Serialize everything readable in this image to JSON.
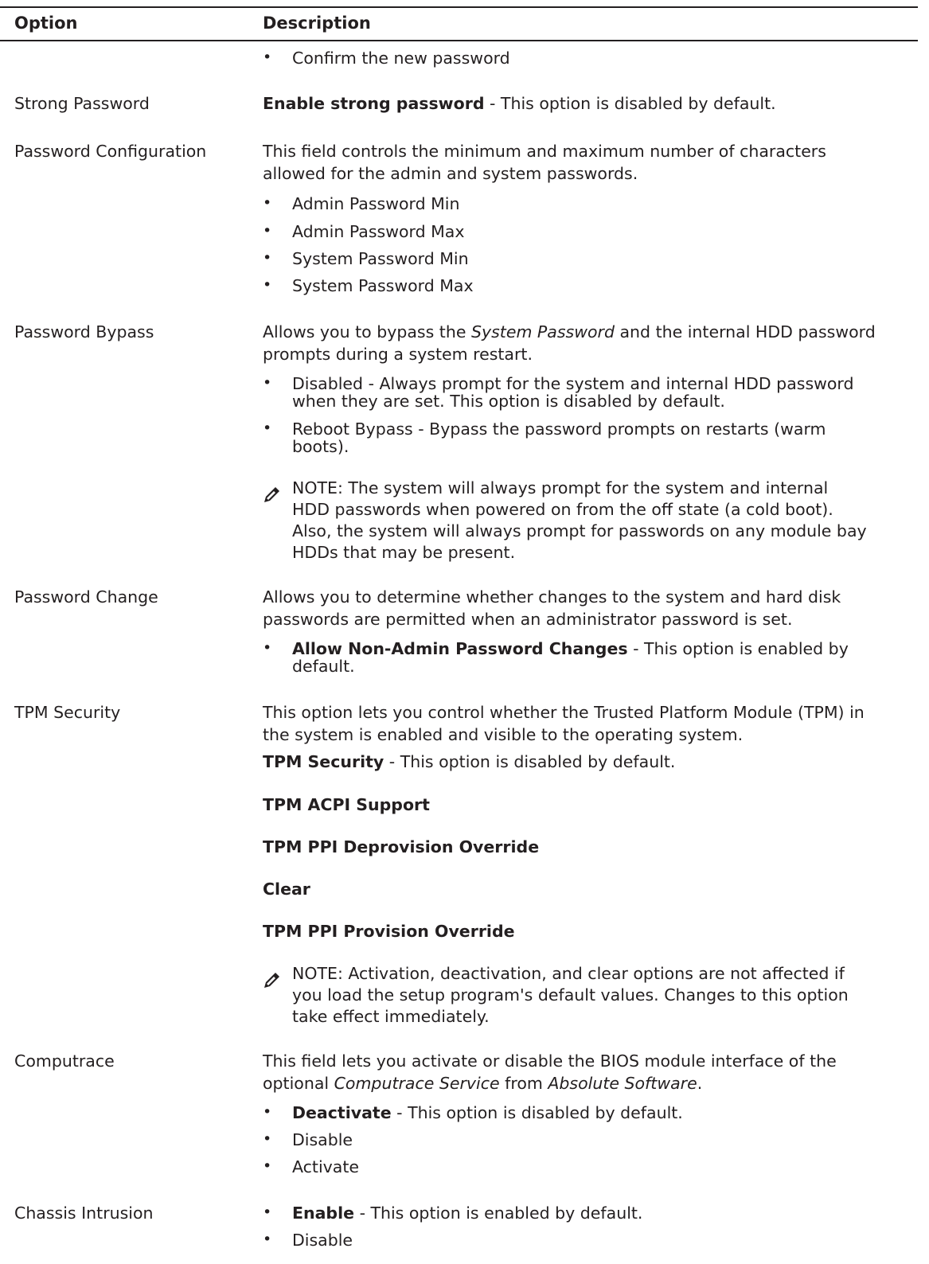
{
  "header": {
    "option": "Option",
    "description": "Description"
  },
  "rows": {
    "confirm": {
      "bullet": "Confirm the new password"
    },
    "strong": {
      "option": "Strong Password",
      "bold": "Enable strong password",
      "rest": " - This option is disabled by default."
    },
    "pwconfig": {
      "option": "Password Configuration",
      "desc1": "This field controls the minimum and maximum number of characters",
      "desc2": "allowed for the admin and system passwords.",
      "items": [
        "Admin Password Min",
        "Admin Password Max",
        "System Password Min",
        "System Password Max"
      ]
    },
    "bypass": {
      "option": "Password Bypass",
      "desc1a": "Allows you to bypass the ",
      "desc1i": "System Password",
      "desc1b": " and the internal HDD password",
      "desc2": "prompts during a system restart.",
      "item1a": "Disabled - Always prompt for the system and internal HDD password",
      "item1b": "when they are set. This option is disabled by default.",
      "item2a": "Reboot Bypass - Bypass the password prompts on restarts (warm",
      "item2b": "boots).",
      "note_label": "NOTE:",
      "note1": " The system will always prompt for the system and internal",
      "note2": "HDD passwords when powered on from the off state (a cold boot).",
      "note3": "Also, the system will always prompt for passwords on any module bay",
      "note4": "HDDs that may be present."
    },
    "change": {
      "option": "Password Change",
      "desc1": "Allows you to determine whether changes to the system and hard disk",
      "desc2": "passwords are permitted when an administrator password is set.",
      "item_bold": "Allow Non-Admin Password Changes",
      "item_rest": " - This option is enabled by",
      "item2": "default."
    },
    "tpm": {
      "option": "TPM Security",
      "desc1": "This option lets you control whether the Trusted Platform Module (TPM) in",
      "desc2": "the system is enabled and visible to the operating system.",
      "sec_bold": "TPM Security",
      "sec_rest": " - This option is disabled by default.",
      "acpi": "TPM ACPI Support",
      "deprov": "TPM PPI Deprovision Override",
      "clear": "Clear",
      "prov": "TPM PPI Provision Override",
      "note_label": "NOTE:",
      "note1": " Activation, deactivation, and clear options are not affected if",
      "note2": "you load the setup program's default values. Changes to this option",
      "note3": "take effect immediately."
    },
    "computrace": {
      "option": "Computrace",
      "desc1": "This field lets you activate or disable the BIOS module interface of the",
      "desc2a": "optional ",
      "desc2i1": "Computrace Service",
      "desc2m": " from ",
      "desc2i2": "Absolute Software",
      "desc2e": ".",
      "item1_bold": "Deactivate",
      "item1_rest": " - This option is disabled by default.",
      "item2": "Disable",
      "item3": "Activate"
    },
    "chassis": {
      "option": "Chassis Intrusion",
      "item1_bold": "Enable",
      "item1_rest": " - This option is enabled by default.",
      "item2": "Disable"
    }
  },
  "icons": {
    "note": "note-pencil-icon"
  }
}
